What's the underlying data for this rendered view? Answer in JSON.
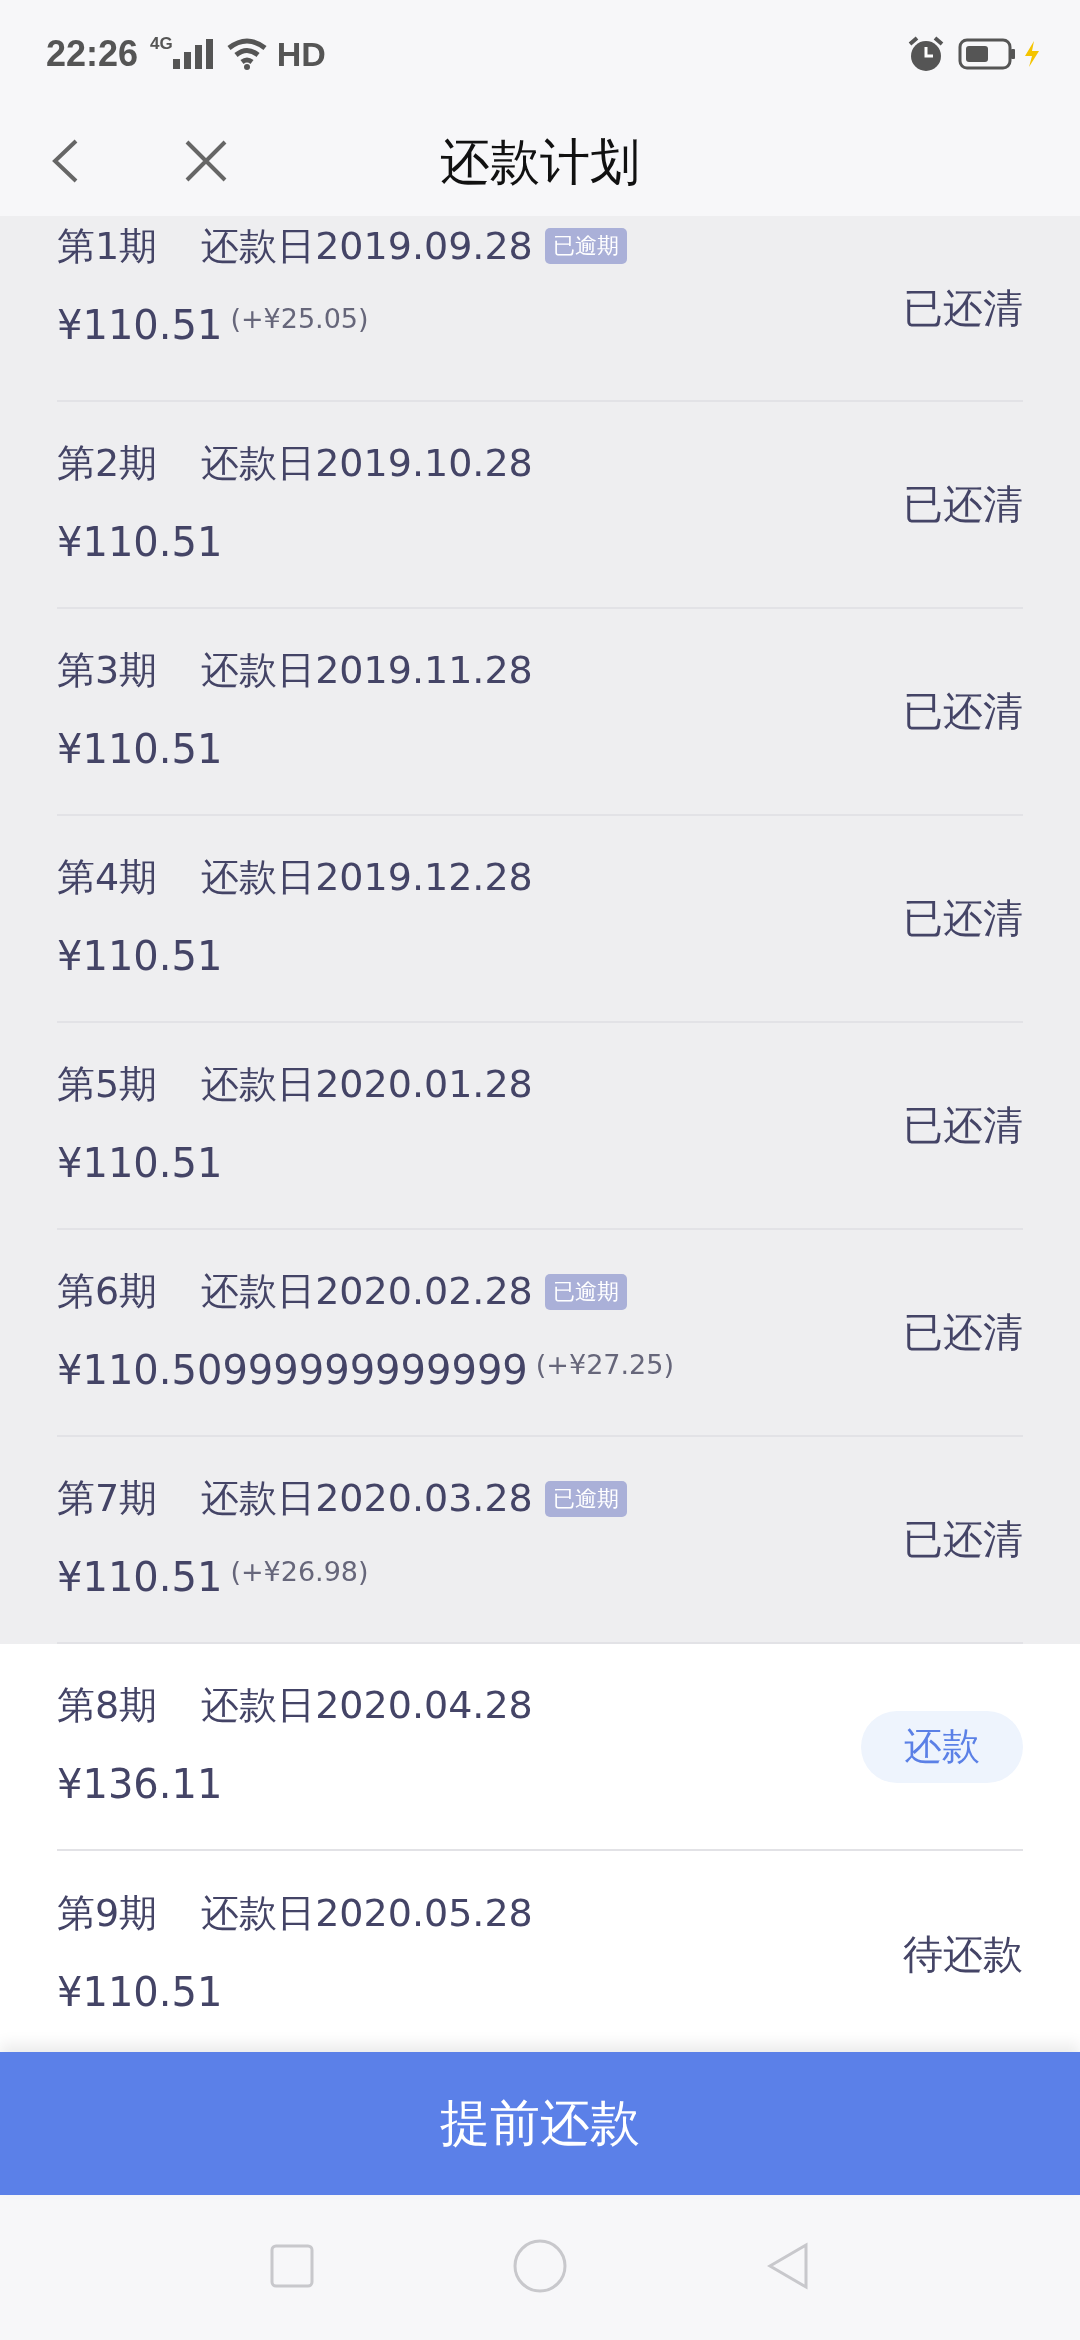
{
  "status_bar": {
    "time": "22:26",
    "network": "4G",
    "hd": "HD"
  },
  "header": {
    "title": "还款计划"
  },
  "installments": [
    {
      "period": "第1期",
      "due_date": "还款日2019.09.28",
      "overdue": true,
      "overdue_label": "已逾期",
      "amount": "¥110.51",
      "late_fee": "(+¥25.05)",
      "paid": true,
      "status": {
        "kind": "text",
        "label": "已还清"
      }
    },
    {
      "period": "第2期",
      "due_date": "还款日2019.10.28",
      "overdue": false,
      "amount": "¥110.51",
      "paid": true,
      "status": {
        "kind": "text",
        "label": "已还清"
      }
    },
    {
      "period": "第3期",
      "due_date": "还款日2019.11.28",
      "overdue": false,
      "amount": "¥110.51",
      "paid": true,
      "status": {
        "kind": "text",
        "label": "已还清"
      }
    },
    {
      "period": "第4期",
      "due_date": "还款日2019.12.28",
      "overdue": false,
      "amount": "¥110.51",
      "paid": true,
      "status": {
        "kind": "text",
        "label": "已还清"
      }
    },
    {
      "period": "第5期",
      "due_date": "还款日2020.01.28",
      "overdue": false,
      "amount": "¥110.51",
      "paid": true,
      "status": {
        "kind": "text",
        "label": "已还清"
      }
    },
    {
      "period": "第6期",
      "due_date": "还款日2020.02.28",
      "overdue": true,
      "overdue_label": "已逾期",
      "amount": "¥110.50999999999999",
      "late_fee": "(+¥27.25)",
      "paid": true,
      "status": {
        "kind": "text",
        "label": "已还清"
      }
    },
    {
      "period": "第7期",
      "due_date": "还款日2020.03.28",
      "overdue": true,
      "overdue_label": "已逾期",
      "amount": "¥110.51",
      "late_fee": "(+¥26.98)",
      "paid": true,
      "status": {
        "kind": "text",
        "label": "已还清"
      }
    },
    {
      "period": "第8期",
      "due_date": "还款日2020.04.28",
      "overdue": false,
      "amount": "¥136.11",
      "paid": false,
      "status": {
        "kind": "button",
        "label": "还款"
      }
    },
    {
      "period": "第9期",
      "due_date": "还款日2020.05.28",
      "overdue": false,
      "amount": "¥110.51",
      "paid": false,
      "status": {
        "kind": "text",
        "label": "待还款"
      }
    }
  ],
  "prepay_button": {
    "label": "提前还款"
  }
}
